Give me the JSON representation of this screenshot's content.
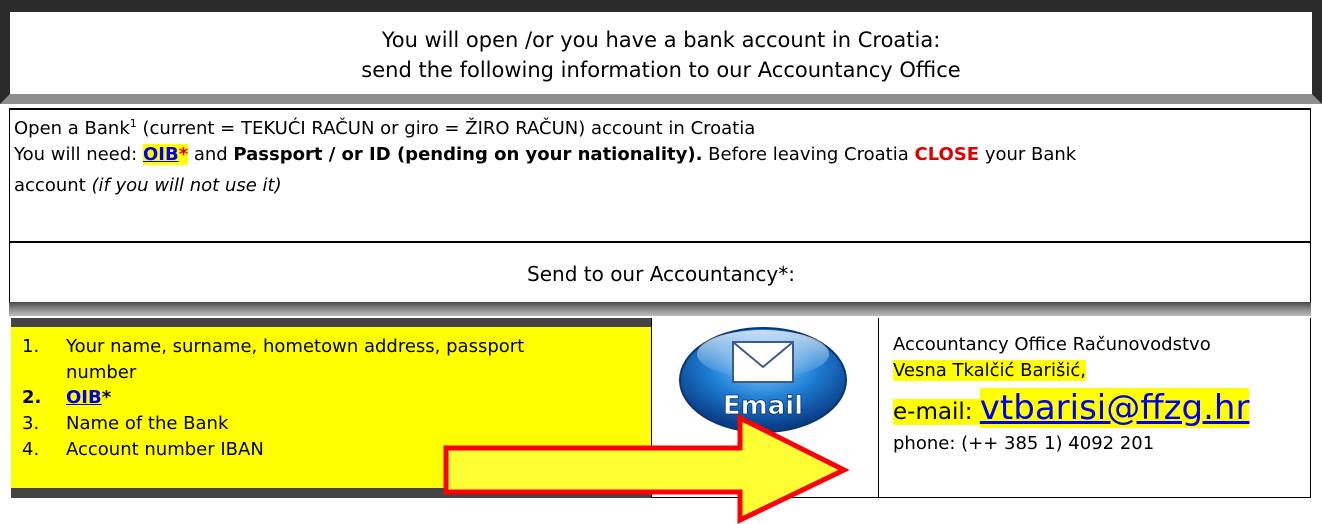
{
  "header": {
    "line1": "You will open /or you have a bank account in Croatia:",
    "line2": "send the following information to our Accountancy Office"
  },
  "bank_paragraph": {
    "line1_a": "Open a Bank",
    "line1_sup": "1",
    "line1_b": " (current = TEKUĆI RAČUN or giro = ŽIRO RAČUN) account in Croatia",
    "line2_a": "You will need: ",
    "line2_oib": "OIB",
    "line2_star": "*",
    "line2_b": " and ",
    "line2_passport": "Passport / or ID (pending on your nationality).",
    "line2_c": " Before leaving Croatia ",
    "line2_close": "CLOSE",
    "line2_d": " your Bank",
    "line3_a": "account ",
    "line3_italic": "(if you will not use it)"
  },
  "send_heading": "Send to our Accountancy*:",
  "list": [
    {
      "num": "1.",
      "text": "Your name, surname, hometown address, passport"
    },
    {
      "num": "",
      "text": "number"
    },
    {
      "num": "2.",
      "text": "OIB",
      "suffix": "*"
    },
    {
      "num": "3.",
      "text": "Name of the Bank"
    },
    {
      "num": "4.",
      "text": "Account number  IBAN"
    }
  ],
  "email_icon_label": "Email",
  "contact": {
    "office": "Accountancy Office Računovodstvo",
    "name": "Vesna Tkalčić Barišić,",
    "email_label": "e-mail: ",
    "email": "vtbarisi@ffzg.hr",
    "phone": "phone: (++ 385 1) 4092 201"
  },
  "colors": {
    "highlight": "#ffff00",
    "link": "#0000ee",
    "alert": "#e00000",
    "arrow_fill": "#ffff33",
    "arrow_stroke": "#ff0000"
  }
}
